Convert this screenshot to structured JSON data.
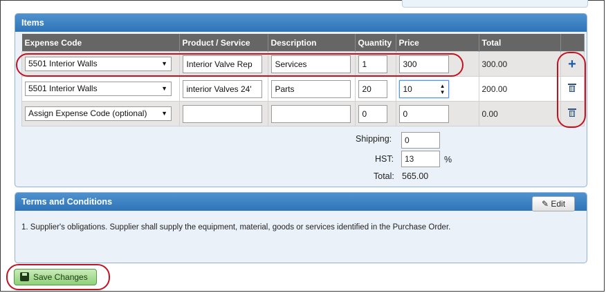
{
  "items_panel": {
    "title": "Items",
    "columns": [
      "Expense Code",
      "Product / Service",
      "Description",
      "Quantity",
      "Price",
      "Total"
    ],
    "rows": [
      {
        "expense_code": "5501 Interior Walls",
        "product": "Interior Valve Rep",
        "description": "Services",
        "quantity": "1",
        "price": "300",
        "total": "300.00",
        "action_icon": "plus-icon"
      },
      {
        "expense_code": "5501 Interior Walls",
        "product": "interior Valves 24'",
        "description": "Parts",
        "quantity": "20",
        "price": "10",
        "total": "200.00",
        "action_icon": "trash-icon"
      },
      {
        "expense_code": "Assign Expense Code (optional)",
        "product": "",
        "description": "",
        "quantity": "0",
        "price": "0",
        "total": "0.00",
        "action_icon": "trash-icon"
      }
    ],
    "shipping_label": "Shipping:",
    "shipping_value": "0",
    "hst_label": "HST:",
    "hst_value": "13",
    "hst_unit": "%",
    "total_label": "Total:",
    "total_value": "565.00"
  },
  "terms_panel": {
    "title": "Terms and Conditions",
    "edit_label": "Edit",
    "text": "1. Supplier's obligations. Supplier shall supply the equipment, material, goods or services identified in the Purchase Order."
  },
  "save_label": "Save Changes",
  "colors": {
    "panel_header": "#2f74b8",
    "table_header": "#666666",
    "highlight_ring": "#c1121f",
    "save_button": "#8fd07a"
  }
}
